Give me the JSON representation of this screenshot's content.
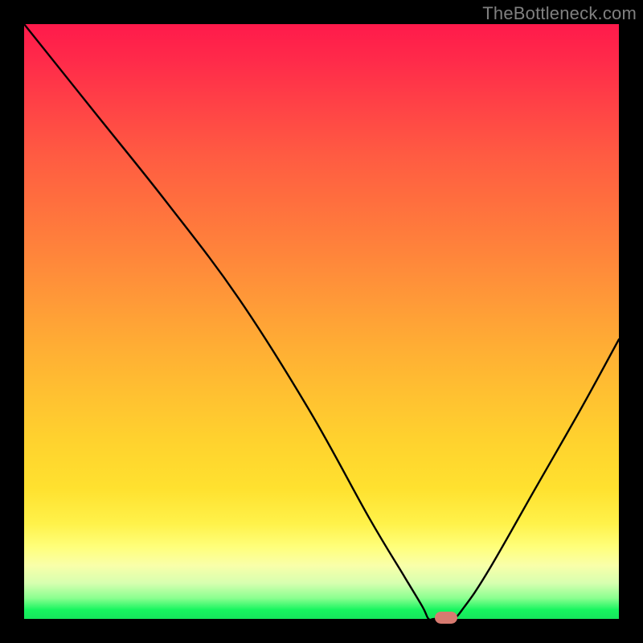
{
  "watermark": "TheBottleneck.com",
  "chart_data": {
    "type": "line",
    "title": "",
    "xlabel": "",
    "ylabel": "",
    "xlim": [
      0,
      100
    ],
    "ylim": [
      0,
      100
    ],
    "grid": false,
    "series": [
      {
        "name": "bottleneck-curve",
        "x": [
          0,
          12,
          24,
          36,
          48,
          58,
          64,
          67,
          68,
          69,
          72,
          74,
          78,
          86,
          94,
          100
        ],
        "y": [
          100,
          85,
          70,
          54,
          35,
          17,
          7,
          2,
          0,
          0,
          0,
          2,
          8,
          22,
          36,
          47
        ]
      }
    ],
    "marker": {
      "x": 71,
      "y": 0,
      "color": "#d77a70"
    },
    "gradient_stops": [
      {
        "pct": 0,
        "color": "#ff1a4b"
      },
      {
        "pct": 14,
        "color": "#ff4346"
      },
      {
        "pct": 30,
        "color": "#ff6f3e"
      },
      {
        "pct": 46,
        "color": "#ff9838"
      },
      {
        "pct": 62,
        "color": "#ffc031"
      },
      {
        "pct": 78,
        "color": "#ffe12f"
      },
      {
        "pct": 88,
        "color": "#ffff7c"
      },
      {
        "pct": 94,
        "color": "#d7ffb0"
      },
      {
        "pct": 98.5,
        "color": "#17f55f"
      },
      {
        "pct": 100,
        "color": "#16e65c"
      }
    ]
  }
}
